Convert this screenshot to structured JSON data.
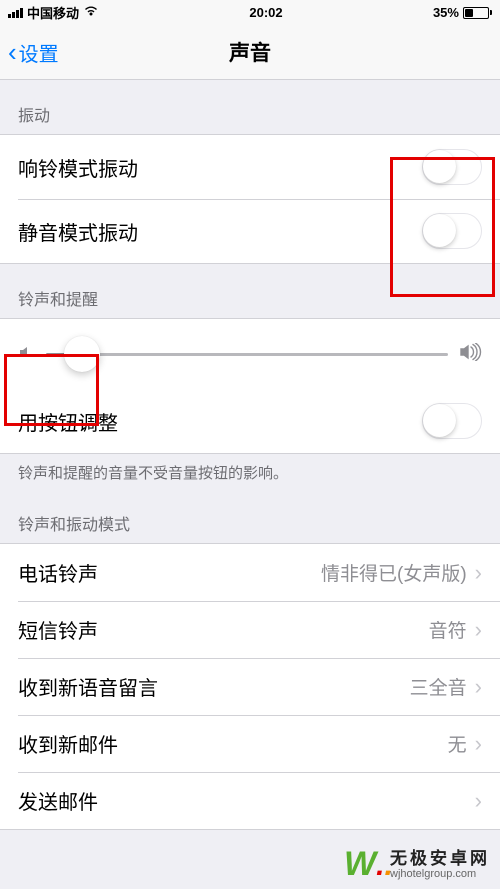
{
  "status": {
    "carrier": "中国移动",
    "time": "20:02",
    "battery": "35%"
  },
  "nav": {
    "back": "设置",
    "title": "声音"
  },
  "sections": {
    "vibrate_header": "振动",
    "ringtone_header": "铃声和提醒",
    "ringtone_footer": "铃声和提醒的音量不受音量按钮的影响。",
    "pattern_header": "铃声和振动模式"
  },
  "cells": {
    "vibrate_ring": "响铃模式振动",
    "vibrate_silent": "静音模式振动",
    "change_with_buttons": "用按钮调整",
    "ringtone": {
      "label": "电话铃声",
      "value": "情非得已(女声版)"
    },
    "texttone": {
      "label": "短信铃声",
      "value": "音符"
    },
    "voicemail": {
      "label": "收到新语音留言",
      "value": "三全音"
    },
    "newmail": {
      "label": "收到新邮件",
      "value": "无"
    },
    "sentmail": {
      "label": "发送邮件"
    }
  },
  "watermark": {
    "cn": "无极安卓网",
    "en": "wjhotelgroup.com"
  }
}
